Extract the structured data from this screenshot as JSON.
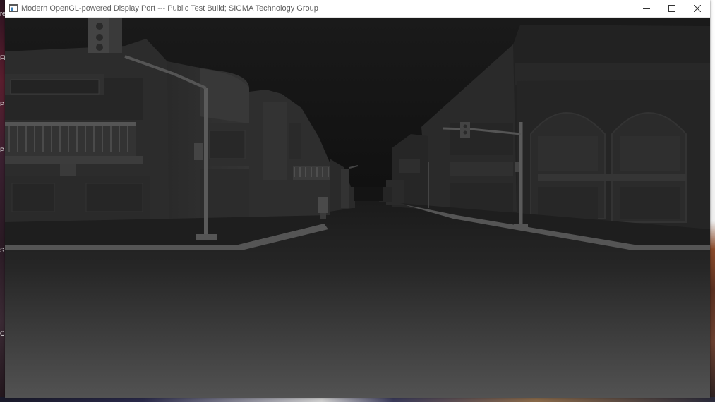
{
  "window": {
    "title": "Modern OpenGL-powered Display Port --- Public Test Build; SIGMA Technology Group",
    "controls": {
      "minimize_icon": "minimize-icon",
      "maximize_icon": "maximize-icon",
      "close_icon": "close-icon"
    }
  },
  "desktop": {
    "edge_letters": [
      "re",
      "Fi",
      "P",
      "P",
      "S",
      "C"
    ]
  },
  "colors": {
    "titlebar_bg": "#ffffff",
    "title_text": "#606060",
    "scene_sky": "#161616",
    "scene_ground": "#4a4a4a"
  }
}
